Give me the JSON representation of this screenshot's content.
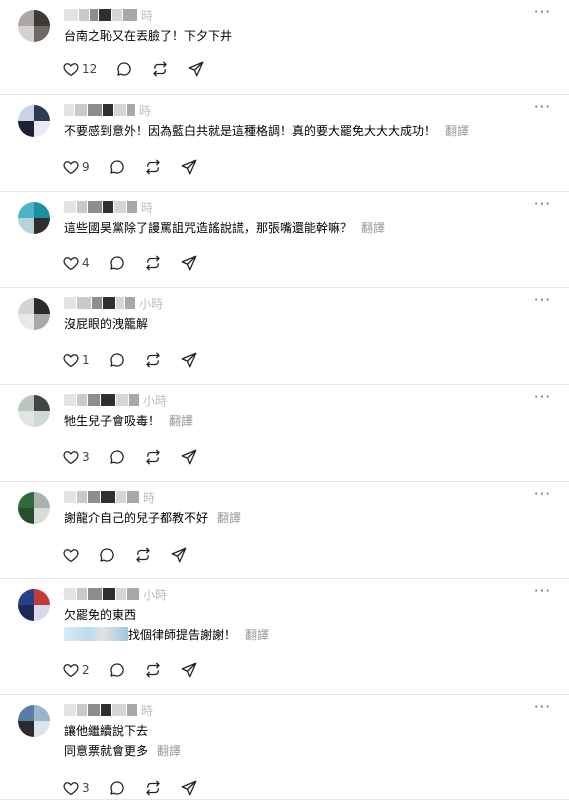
{
  "feed": {
    "more_icon": "more-horizontal-icon",
    "action_icons": [
      "heart-icon",
      "comment-icon",
      "repost-icon",
      "send-icon"
    ],
    "posts": [
      {
        "time": "時",
        "lines": [
          "台南之恥又在丟臉了！下夕下井"
        ],
        "translate_label": "",
        "likes": "12"
      },
      {
        "time": "時",
        "lines": [
          "不要感到意外！因為藍白共就是這種格調！真的要大罷免大大大成功！"
        ],
        "translate_label": "翻譯",
        "likes": "9"
      },
      {
        "time": "時",
        "lines": [
          "這些國昊黨除了謾罵詛咒造謠說謊，那張嘴還能幹嘛？"
        ],
        "translate_label": "翻譯",
        "likes": "4"
      },
      {
        "time": "小時",
        "lines": [
          "沒屁眼的洩籠解"
        ],
        "translate_label": "",
        "likes": "1"
      },
      {
        "time": "小時",
        "lines": [
          "牠生兒子會吸毒！"
        ],
        "translate_label": "翻譯",
        "likes": "3"
      },
      {
        "time": "時",
        "lines": [
          "謝龍介自己的兒子都教不好"
        ],
        "translate_label": "翻譯",
        "likes": ""
      },
      {
        "time": "小時",
        "lines": [
          "欠罷免的東西",
          "找個律師提告謝謝！"
        ],
        "translate_label": "翻譯",
        "likes": "2"
      },
      {
        "time": "時",
        "lines": [
          "讓他繼續說下去",
          "同意票就會更多"
        ],
        "translate_label": "翻譯",
        "likes": "3"
      }
    ]
  }
}
